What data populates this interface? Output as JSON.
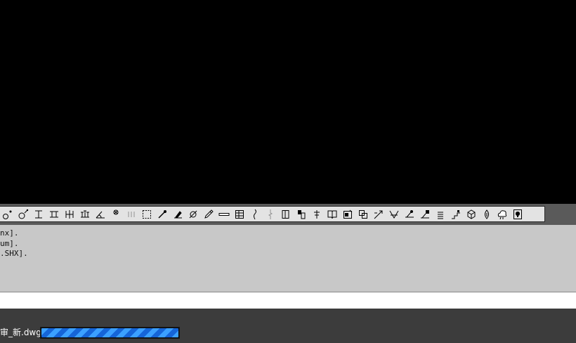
{
  "toolbar": {
    "buttons": [
      {
        "icon": "dim-radius-icon"
      },
      {
        "icon": "dim-diameter-icon"
      },
      {
        "icon": "dim-baseline-icon"
      },
      {
        "icon": "dim-continue-icon"
      },
      {
        "icon": "dim-symmetric-icon"
      },
      {
        "icon": "dim-ordinate-icon"
      },
      {
        "icon": "dim-angle-icon"
      },
      {
        "icon": "break-point-icon"
      },
      {
        "icon": "separator-icon",
        "dim": true
      },
      {
        "icon": "select-window-icon"
      },
      {
        "icon": "pick-point-icon"
      },
      {
        "icon": "hatch-brush-icon"
      },
      {
        "icon": "circle-slash-icon"
      },
      {
        "icon": "pencil-edit-icon"
      },
      {
        "icon": "line-bar-icon"
      },
      {
        "icon": "table-icon"
      },
      {
        "icon": "wave-line-icon"
      },
      {
        "icon": "break-line-icon",
        "dim": true
      },
      {
        "icon": "door-icon"
      },
      {
        "icon": "window-icon"
      },
      {
        "icon": "text-icon"
      },
      {
        "icon": "book-icon"
      },
      {
        "icon": "image-edit-icon"
      },
      {
        "icon": "copy-block-icon"
      },
      {
        "icon": "arrow-leader-icon"
      },
      {
        "icon": "mark-check-icon"
      },
      {
        "icon": "leader-icon"
      },
      {
        "icon": "leader-note-icon"
      },
      {
        "icon": "stack-icon"
      },
      {
        "icon": "stairs-icon"
      },
      {
        "icon": "cube-icon"
      },
      {
        "icon": "drop-icon"
      },
      {
        "icon": "cloud-icon"
      },
      {
        "icon": "bulb-icon"
      }
    ]
  },
  "command_history": {
    "lines": [
      "nx].",
      "um].",
      ".SHX]."
    ]
  },
  "status": {
    "file_name": "审_新.dwg",
    "progress": 1.0
  },
  "colors": {
    "drawing_bg": "#000000",
    "command_bg": "#c8c8c8",
    "status_bg": "#3c3c3c",
    "progress_light": "#3ba0ff",
    "progress_dark": "#1565d8"
  }
}
